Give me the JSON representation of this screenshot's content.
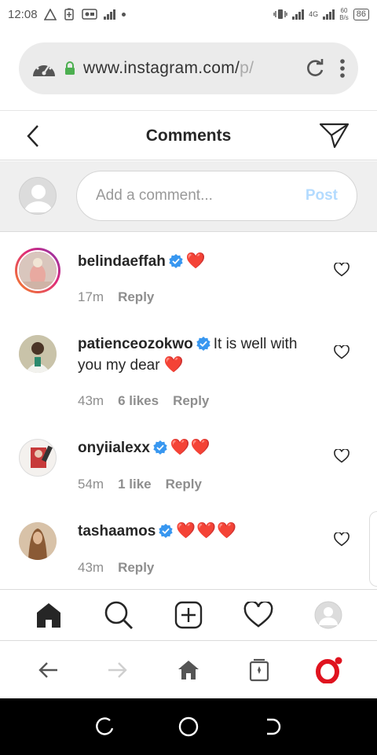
{
  "status_bar": {
    "time": "12:08",
    "network_type": "4G",
    "net_speed": "60",
    "net_speed_unit": "B/s",
    "battery": "86"
  },
  "browser": {
    "url_main": "www.instagram.com/",
    "url_faded": "p/",
    "lock_color": "#4caf50"
  },
  "header": {
    "title": "Comments"
  },
  "add_comment": {
    "placeholder": "Add a comment...",
    "post_label": "Post"
  },
  "comments": [
    {
      "username": "belindaeffah",
      "verified": true,
      "text": "",
      "hearts": "❤️",
      "time": "17m",
      "likes": "",
      "reply": "Reply"
    },
    {
      "username": "patienceozokwo",
      "verified": true,
      "text": "It is well with you my dear",
      "hearts": "❤️",
      "time": "43m",
      "likes": "6 likes",
      "reply": "Reply"
    },
    {
      "username": "onyiialexx",
      "verified": true,
      "text": "",
      "hearts": "❤️❤️",
      "time": "54m",
      "likes": "1 like",
      "reply": "Reply"
    },
    {
      "username": "tashaamos",
      "verified": true,
      "text": "",
      "hearts": "❤️❤️❤️",
      "time": "43m",
      "likes": "",
      "reply": "Reply"
    }
  ],
  "icons": {
    "tabs": [
      "home-icon",
      "search-icon",
      "new-post-icon",
      "activity-heart-icon",
      "profile-avatar-icon"
    ],
    "browser_nav": [
      "back-arrow-icon",
      "forward-arrow-icon",
      "browser-home-icon",
      "tabs-icon",
      "opera-menu-icon"
    ],
    "android_nav": [
      "recents-icon",
      "home-circle-icon",
      "back-icon"
    ]
  },
  "colors": {
    "verified_blue": "#3897f0",
    "heart_red": "#e0202e",
    "post_disabled": "#b3dbff",
    "opera_red": "#e0131f"
  }
}
